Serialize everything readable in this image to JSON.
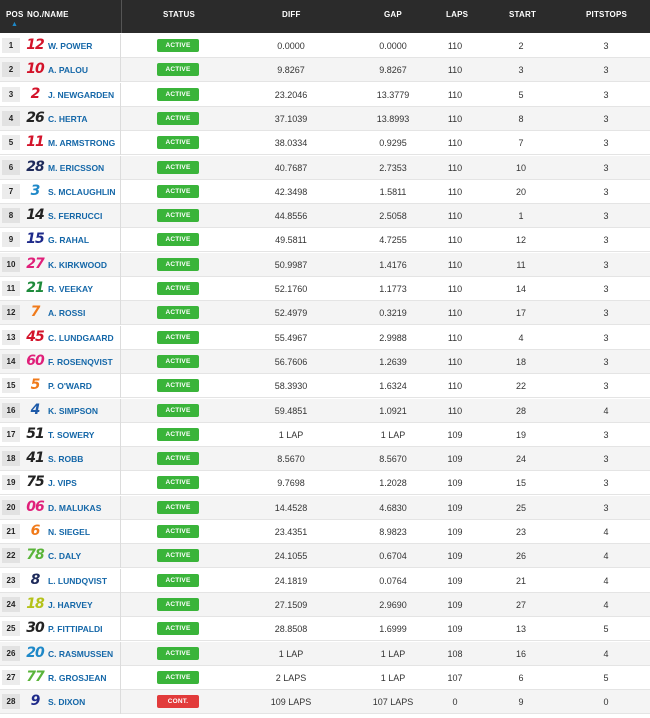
{
  "header": {
    "pos": "POS",
    "num_name": "NO./NAME",
    "status": "STATUS",
    "diff": "DIFF",
    "gap": "GAP",
    "laps": "LAPS",
    "start": "START",
    "pitstops": "PITSTOPS",
    "sort_icon": "sort-icon"
  },
  "colors": {
    "header_bg": "#2b2b2b",
    "active": "#3ab43a",
    "contact": "#e23b3b",
    "name_link": "#1467a8"
  },
  "rows": [
    {
      "pos": "1",
      "num": "12",
      "numColor": "#d3132a",
      "name": "W. POWER",
      "status": "ACTIVE",
      "diff": "0.0000",
      "gap": "0.0000",
      "laps": "110",
      "start": "2",
      "pitstops": "3"
    },
    {
      "pos": "2",
      "num": "10",
      "numColor": "#d3132a",
      "name": "A. PALOU",
      "status": "ACTIVE",
      "diff": "9.8267",
      "gap": "9.8267",
      "laps": "110",
      "start": "3",
      "pitstops": "3"
    },
    {
      "pos": "3",
      "num": "2",
      "numColor": "#d3132a",
      "name": "J. NEWGARDEN",
      "status": "ACTIVE",
      "diff": "23.2046",
      "gap": "13.3779",
      "laps": "110",
      "start": "5",
      "pitstops": "3"
    },
    {
      "pos": "4",
      "num": "26",
      "numColor": "#222222",
      "name": "C. HERTA",
      "status": "ACTIVE",
      "diff": "37.1039",
      "gap": "13.8993",
      "laps": "110",
      "start": "8",
      "pitstops": "3"
    },
    {
      "pos": "5",
      "num": "11",
      "numColor": "#d3132a",
      "name": "M. ARMSTRONG",
      "status": "ACTIVE",
      "diff": "38.0334",
      "gap": "0.9295",
      "laps": "110",
      "start": "7",
      "pitstops": "3"
    },
    {
      "pos": "6",
      "num": "28",
      "numColor": "#1e2a5a",
      "name": "M. ERICSSON",
      "status": "ACTIVE",
      "diff": "40.7687",
      "gap": "2.7353",
      "laps": "110",
      "start": "10",
      "pitstops": "3"
    },
    {
      "pos": "7",
      "num": "3",
      "numColor": "#1e88c8",
      "name": "S. MCLAUGHLIN",
      "status": "ACTIVE",
      "diff": "42.3498",
      "gap": "1.5811",
      "laps": "110",
      "start": "20",
      "pitstops": "3"
    },
    {
      "pos": "8",
      "num": "14",
      "numColor": "#222222",
      "name": "S. FERRUCCI",
      "status": "ACTIVE",
      "diff": "44.8556",
      "gap": "2.5058",
      "laps": "110",
      "start": "1",
      "pitstops": "3"
    },
    {
      "pos": "9",
      "num": "15",
      "numColor": "#1e2a8a",
      "name": "G. RAHAL",
      "status": "ACTIVE",
      "diff": "49.5811",
      "gap": "4.7255",
      "laps": "110",
      "start": "12",
      "pitstops": "3"
    },
    {
      "pos": "10",
      "num": "27",
      "numColor": "#e0207a",
      "name": "K. KIRKWOOD",
      "status": "ACTIVE",
      "diff": "50.9987",
      "gap": "1.4176",
      "laps": "110",
      "start": "11",
      "pitstops": "3"
    },
    {
      "pos": "11",
      "num": "21",
      "numColor": "#1d8a3a",
      "name": "R. VEEKAY",
      "status": "ACTIVE",
      "diff": "52.1760",
      "gap": "1.1773",
      "laps": "110",
      "start": "14",
      "pitstops": "3"
    },
    {
      "pos": "12",
      "num": "7",
      "numColor": "#f07a1a",
      "name": "A. ROSSI",
      "status": "ACTIVE",
      "diff": "52.4979",
      "gap": "0.3219",
      "laps": "110",
      "start": "17",
      "pitstops": "3"
    },
    {
      "pos": "13",
      "num": "45",
      "numColor": "#d3132a",
      "name": "C. LUNDGAARD",
      "status": "ACTIVE",
      "diff": "55.4967",
      "gap": "2.9988",
      "laps": "110",
      "start": "4",
      "pitstops": "3"
    },
    {
      "pos": "14",
      "num": "60",
      "numColor": "#e0207a",
      "name": "F. ROSENQVIST",
      "status": "ACTIVE",
      "diff": "56.7606",
      "gap": "1.2639",
      "laps": "110",
      "start": "18",
      "pitstops": "3"
    },
    {
      "pos": "15",
      "num": "5",
      "numColor": "#f07a1a",
      "name": "P. O'WARD",
      "status": "ACTIVE",
      "diff": "58.3930",
      "gap": "1.6324",
      "laps": "110",
      "start": "22",
      "pitstops": "3"
    },
    {
      "pos": "16",
      "num": "4",
      "numColor": "#1e5aa8",
      "name": "K. SIMPSON",
      "status": "ACTIVE",
      "diff": "59.4851",
      "gap": "1.0921",
      "laps": "110",
      "start": "28",
      "pitstops": "4"
    },
    {
      "pos": "17",
      "num": "51",
      "numColor": "#222222",
      "name": "T. SOWERY",
      "status": "ACTIVE",
      "diff": "1 LAP",
      "gap": "1 LAP",
      "laps": "109",
      "start": "19",
      "pitstops": "3"
    },
    {
      "pos": "18",
      "num": "41",
      "numColor": "#222222",
      "name": "S. ROBB",
      "status": "ACTIVE",
      "diff": "8.5670",
      "gap": "8.5670",
      "laps": "109",
      "start": "24",
      "pitstops": "3"
    },
    {
      "pos": "19",
      "num": "75",
      "numColor": "#222222",
      "name": "J. VIPS",
      "status": "ACTIVE",
      "diff": "9.7698",
      "gap": "1.2028",
      "laps": "109",
      "start": "15",
      "pitstops": "3"
    },
    {
      "pos": "20",
      "num": "06",
      "numColor": "#e0207a",
      "name": "D. MALUKAS",
      "status": "ACTIVE",
      "diff": "14.4528",
      "gap": "4.6830",
      "laps": "109",
      "start": "25",
      "pitstops": "3"
    },
    {
      "pos": "21",
      "num": "6",
      "numColor": "#f07a1a",
      "name": "N. SIEGEL",
      "status": "ACTIVE",
      "diff": "23.4351",
      "gap": "8.9823",
      "laps": "109",
      "start": "23",
      "pitstops": "4"
    },
    {
      "pos": "22",
      "num": "78",
      "numColor": "#5ab43a",
      "name": "C. DALY",
      "status": "ACTIVE",
      "diff": "24.1055",
      "gap": "0.6704",
      "laps": "109",
      "start": "26",
      "pitstops": "4"
    },
    {
      "pos": "23",
      "num": "8",
      "numColor": "#1e2a5a",
      "name": "L. LUNDQVIST",
      "status": "ACTIVE",
      "diff": "24.1819",
      "gap": "0.0764",
      "laps": "109",
      "start": "21",
      "pitstops": "4"
    },
    {
      "pos": "24",
      "num": "18",
      "numColor": "#b5c21a",
      "name": "J. HARVEY",
      "status": "ACTIVE",
      "diff": "27.1509",
      "gap": "2.9690",
      "laps": "109",
      "start": "27",
      "pitstops": "4"
    },
    {
      "pos": "25",
      "num": "30",
      "numColor": "#222222",
      "name": "P. FITTIPALDI",
      "status": "ACTIVE",
      "diff": "28.8508",
      "gap": "1.6999",
      "laps": "109",
      "start": "13",
      "pitstops": "5"
    },
    {
      "pos": "26",
      "num": "20",
      "numColor": "#1e88c8",
      "name": "C. RASMUSSEN",
      "status": "ACTIVE",
      "diff": "1 LAP",
      "gap": "1 LAP",
      "laps": "108",
      "start": "16",
      "pitstops": "4"
    },
    {
      "pos": "27",
      "num": "77",
      "numColor": "#5ab43a",
      "name": "R. GROSJEAN",
      "status": "ACTIVE",
      "diff": "2 LAPS",
      "gap": "1 LAP",
      "laps": "107",
      "start": "6",
      "pitstops": "5"
    },
    {
      "pos": "28",
      "num": "9",
      "numColor": "#1e2a8a",
      "name": "S. DIXON",
      "status": "CONT.",
      "diff": "109 LAPS",
      "gap": "107 LAPS",
      "laps": "0",
      "start": "9",
      "pitstops": "0"
    }
  ]
}
